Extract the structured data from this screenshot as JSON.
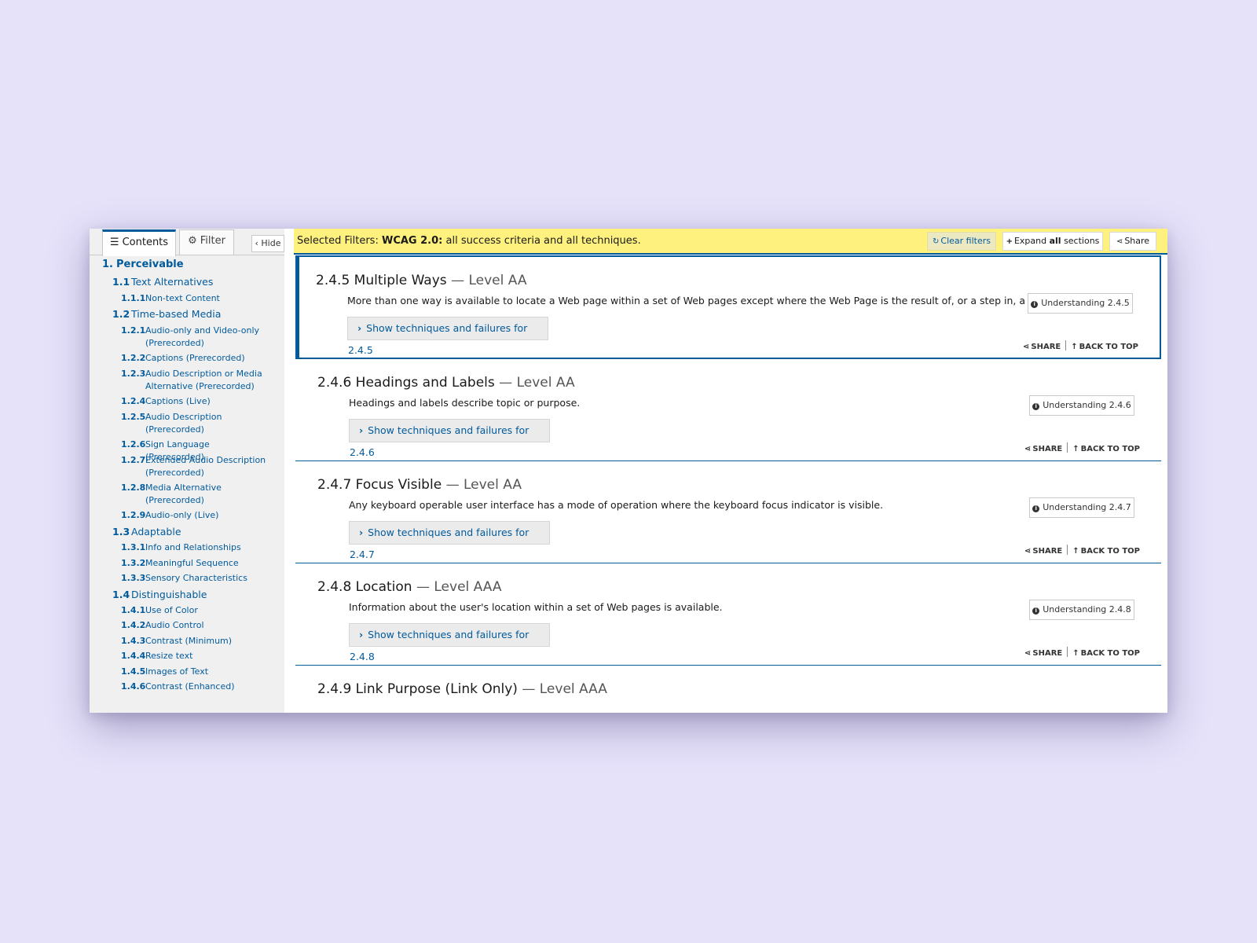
{
  "sidebar": {
    "tabs": {
      "contents": "Contents",
      "filter": "Filter"
    },
    "hide": "Hide",
    "toc": [
      {
        "level": 1,
        "num": "1.",
        "label": "Perceivable"
      },
      {
        "level": 2,
        "num": "1.1",
        "label": "Text Alternatives"
      },
      {
        "level": 3,
        "num": "1.1.1",
        "label": "Non-text Content"
      },
      {
        "level": 2,
        "num": "1.2",
        "label": "Time-based Media"
      },
      {
        "level": 3,
        "num": "1.2.1",
        "label": "Audio-only and Video-only (Prerecorded)"
      },
      {
        "level": 3,
        "num": "1.2.2",
        "label": "Captions (Prerecorded)"
      },
      {
        "level": 3,
        "num": "1.2.3",
        "label": "Audio Description or Media Alternative (Prerecorded)"
      },
      {
        "level": 3,
        "num": "1.2.4",
        "label": "Captions (Live)"
      },
      {
        "level": 3,
        "num": "1.2.5",
        "label": "Audio Description (Prerecorded)"
      },
      {
        "level": 3,
        "num": "1.2.6",
        "label": "Sign Language (Prerecorded)"
      },
      {
        "level": 3,
        "num": "1.2.7",
        "label": "Extended Audio Description (Prerecorded)"
      },
      {
        "level": 3,
        "num": "1.2.8",
        "label": "Media Alternative (Prerecorded)"
      },
      {
        "level": 3,
        "num": "1.2.9",
        "label": "Audio-only (Live)"
      },
      {
        "level": 2,
        "num": "1.3",
        "label": "Adaptable"
      },
      {
        "level": 3,
        "num": "1.3.1",
        "label": "Info and Relationships"
      },
      {
        "level": 3,
        "num": "1.3.2",
        "label": "Meaningful Sequence"
      },
      {
        "level": 3,
        "num": "1.3.3",
        "label": "Sensory Characteristics"
      },
      {
        "level": 2,
        "num": "1.4",
        "label": "Distinguishable"
      },
      {
        "level": 3,
        "num": "1.4.1",
        "label": "Use of Color"
      },
      {
        "level": 3,
        "num": "1.4.2",
        "label": "Audio Control"
      },
      {
        "level": 3,
        "num": "1.4.3",
        "label": "Contrast (Minimum)"
      },
      {
        "level": 3,
        "num": "1.4.4",
        "label": "Resize text"
      },
      {
        "level": 3,
        "num": "1.4.5",
        "label": "Images of Text"
      },
      {
        "level": 3,
        "num": "1.4.6",
        "label": "Contrast (Enhanced)"
      }
    ]
  },
  "filterbar": {
    "prefix": "Selected Filters:",
    "version": "WCAG 2.0:",
    "rest": "all success criteria and all techniques.",
    "clear": "Clear filters",
    "expand_pre": "Expand",
    "expand_bold": "all",
    "expand_post": "sections",
    "share": "Share"
  },
  "sections": [
    {
      "id": "2.4.5",
      "name": "2.4.5 Multiple Ways",
      "level": "— Level AA",
      "desc": "More than one way is available to locate a Web page within a set of Web pages except where the Web Page is the result of, or a step in, a process.",
      "show": "Show techniques and failures for 2.4.5",
      "understanding": "Understanding 2.4.5",
      "active": true
    },
    {
      "id": "2.4.6",
      "name": "2.4.6 Headings and Labels",
      "level": "— Level AA",
      "desc": "Headings and labels describe topic or purpose.",
      "show": "Show techniques and failures for 2.4.6",
      "understanding": "Understanding 2.4.6",
      "active": false
    },
    {
      "id": "2.4.7",
      "name": "2.4.7 Focus Visible",
      "level": "— Level AA",
      "desc": "Any keyboard operable user interface has a mode of operation where the keyboard focus indicator is visible.",
      "show": "Show techniques and failures for 2.4.7",
      "understanding": "Understanding 2.4.7",
      "active": false
    },
    {
      "id": "2.4.8",
      "name": "2.4.8 Location",
      "level": "— Level AAA",
      "desc": "Information about the user's location within a set of Web pages is available.",
      "show": "Show techniques and failures for 2.4.8",
      "understanding": "Understanding 2.4.8",
      "active": false
    },
    {
      "id": "2.4.9",
      "name": "2.4.9 Link Purpose (Link Only)",
      "level": "— Level AAA",
      "desc": "",
      "show": "",
      "understanding": "",
      "active": false
    }
  ],
  "meta": {
    "share": "SHARE",
    "back_to_top": "BACK TO TOP"
  },
  "icons": {
    "contents": "list-icon",
    "filter": "gear-icon",
    "hide": "chevron-left-icon",
    "clear": "refresh-icon",
    "expand": "plus-icon",
    "share": "share-icon",
    "info": "info-icon",
    "show": "chevron-right-icon",
    "back": "arrow-up-icon"
  },
  "colors": {
    "accent": "#005a9c",
    "filterbar": "#fff17e",
    "background": "#e6e2fa"
  }
}
